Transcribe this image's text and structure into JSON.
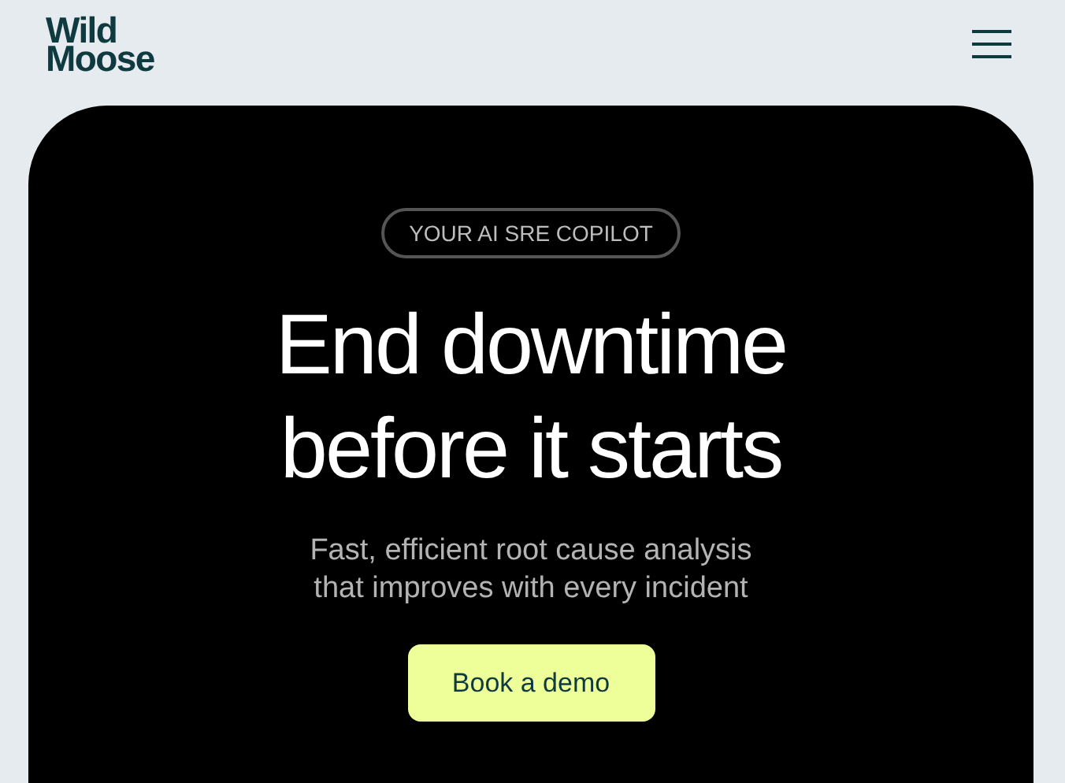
{
  "header": {
    "logo": [
      "Wild",
      "Moose"
    ]
  },
  "hero": {
    "badge": "YOUR AI SRE COPILOT",
    "headline": [
      "End downtime",
      "before it starts"
    ],
    "subtitle": [
      "Fast, efficient root cause analysis",
      "that improves with every incident"
    ],
    "button": "Book a demo"
  }
}
